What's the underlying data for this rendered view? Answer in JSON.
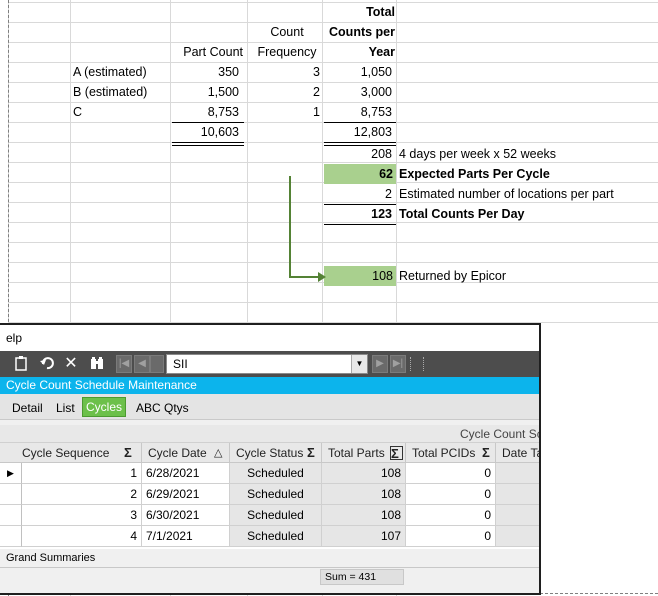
{
  "sheet": {
    "headers": {
      "count_frequency": [
        "Count",
        "Frequency"
      ],
      "part_count": "Part Count",
      "total_counts": [
        "Total",
        "Counts per",
        "Year"
      ]
    },
    "rows": [
      {
        "label": "A (estimated)",
        "part_count": "350",
        "frequency": "3",
        "total": "1,050"
      },
      {
        "label": "B (estimated)",
        "part_count": "1,500",
        "frequency": "2",
        "total": "3,000"
      },
      {
        "label": "C",
        "part_count": "8,753",
        "frequency": "1",
        "total": "8,753"
      }
    ],
    "totals": {
      "part_count": "10,603",
      "total": "12,803"
    },
    "calc": [
      {
        "value": "208",
        "note": "4 days per week x 52 weeks",
        "highlight": false,
        "bold": false
      },
      {
        "value": "62",
        "note": "Expected Parts Per Cycle",
        "highlight": true,
        "bold": true
      },
      {
        "value": "2",
        "note": "Estimated number of locations per part",
        "highlight": false,
        "bold": false
      },
      {
        "value": "123",
        "note": "Total Counts Per Day",
        "highlight": false,
        "bold": true
      }
    ],
    "returned": {
      "value": "108",
      "note": "Returned by Epicor"
    }
  },
  "app": {
    "menu_fragment": "elp",
    "toolbar": {
      "icons": [
        "clipboard-icon",
        "undo-icon",
        "delete-icon",
        "binoculars-icon"
      ],
      "search_value": "SII"
    },
    "title": "Cycle Count Schedule Maintenance",
    "tabs": [
      {
        "label": "Detail",
        "active": false
      },
      {
        "label": "List",
        "active": false
      },
      {
        "label": "Cycles",
        "active": true
      },
      {
        "label": "ABC Qtys",
        "active": false
      }
    ],
    "band_label": "Cycle Count Sc",
    "columns": [
      "Cycle Sequence",
      "Cycle Date",
      "Cycle Status",
      "Total Parts",
      "Total PCIDs",
      "Date Ta"
    ],
    "rows": [
      {
        "seq": "1",
        "date": "6/28/2021",
        "status": "Scheduled",
        "parts": "108",
        "pcids": "0"
      },
      {
        "seq": "2",
        "date": "6/29/2021",
        "status": "Scheduled",
        "parts": "108",
        "pcids": "0"
      },
      {
        "seq": "3",
        "date": "6/30/2021",
        "status": "Scheduled",
        "parts": "108",
        "pcids": "0"
      },
      {
        "seq": "4",
        "date": "7/1/2021",
        "status": "Scheduled",
        "parts": "107",
        "pcids": "0"
      }
    ],
    "grand_summaries_label": "Grand Summaries",
    "sum_label": "Sum = 431"
  },
  "colors": {
    "highlight_green": "#a9d08e",
    "arrow_green": "#548235",
    "title_blue": "#0cb4ec",
    "active_tab_green": "#6cc04a",
    "toolbar_grey": "#4d4d4d"
  }
}
